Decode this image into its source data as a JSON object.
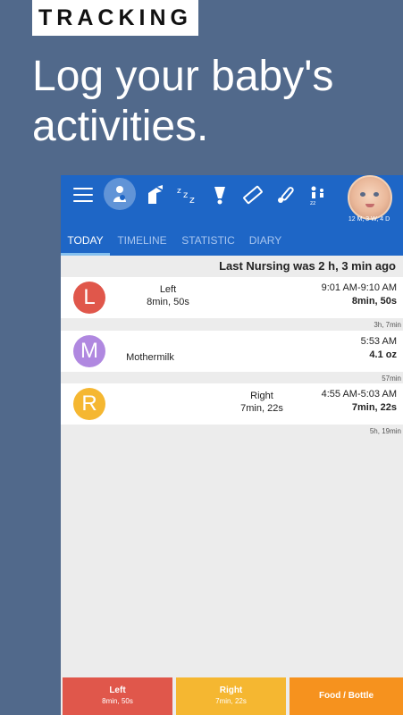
{
  "promo": {
    "badge": "TRACKING",
    "headline": "Log your baby's activities."
  },
  "app": {
    "toolbar_icons": [
      "menu-icon",
      "nursing-icon",
      "bottle-icon",
      "sleep-icon",
      "diaper-icon",
      "ruler-icon",
      "thermometer-icon",
      "medicine-icon"
    ],
    "baby_age": "12 M, 3 W, 4 D",
    "tabs": [
      {
        "label": "TODAY",
        "active": true
      },
      {
        "label": "TIMELINE",
        "active": false
      },
      {
        "label": "STATISTIC",
        "active": false
      },
      {
        "label": "DIARY",
        "active": false
      }
    ],
    "status_text": "Last Nursing  was 2 h,  3 min ago",
    "entries": [
      {
        "letter": "L",
        "color": "#e0574b",
        "label": "Left",
        "detail": "8min, 50s",
        "time": "9:01 AM-9:10 AM",
        "amount": "8min, 50s",
        "gap": "3h, 7min"
      },
      {
        "letter": "M",
        "color": "#b088e0",
        "label": "Mothermilk",
        "detail": "",
        "time": "5:53 AM",
        "amount": "4.1 oz",
        "gap": "57min"
      },
      {
        "letter": "R",
        "color": "#f5b731",
        "label": "Right",
        "detail": "7min, 22s",
        "time": "4:55 AM-5:03 AM",
        "amount": "7min, 22s",
        "gap": "5h, 19min"
      }
    ],
    "buttons": [
      {
        "label": "Left",
        "sub": "8min, 50s",
        "color": "#e0574b"
      },
      {
        "label": "Right",
        "sub": "7min, 22s",
        "color": "#f5b731"
      },
      {
        "label": "Food / Bottle",
        "sub": "",
        "color": "#f6921e"
      }
    ]
  }
}
